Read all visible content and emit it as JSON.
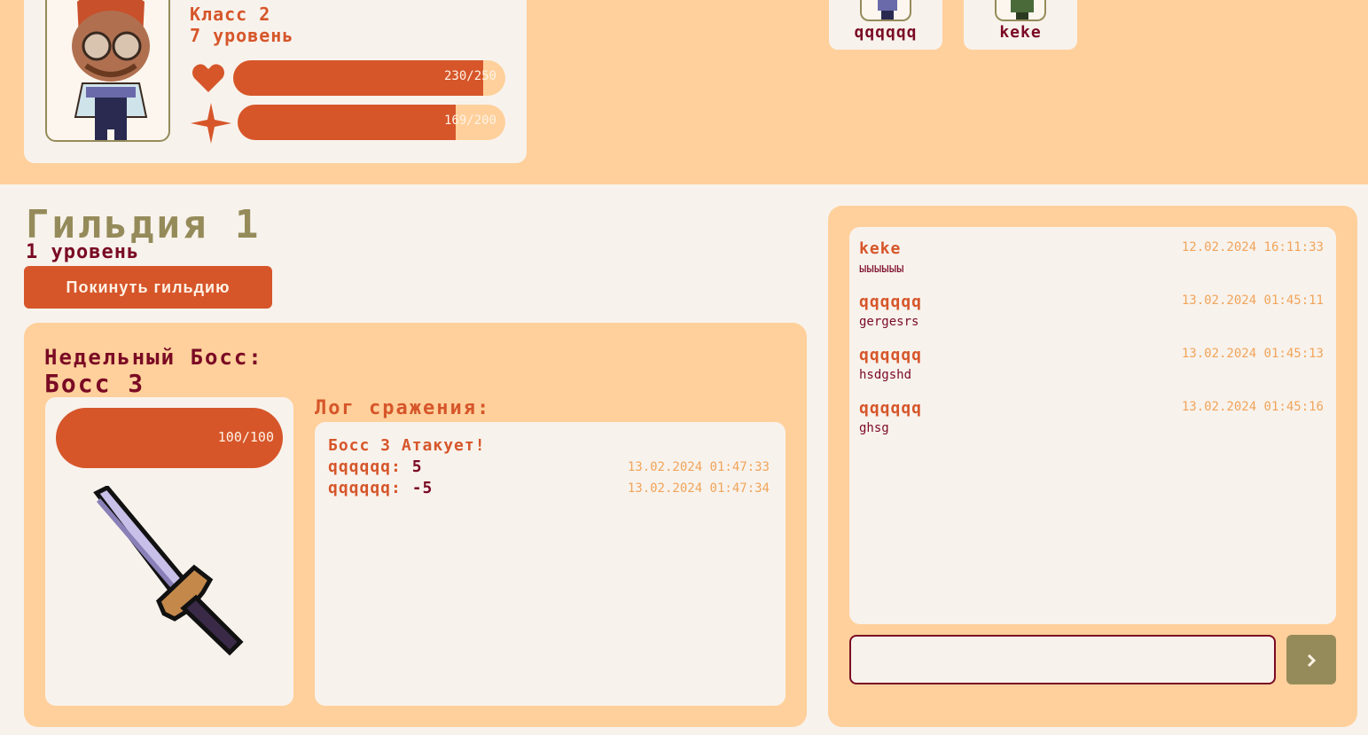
{
  "character": {
    "class_label": "Класс 2",
    "level_label": "7 уровень",
    "hp_text": "230/250",
    "hp_fraction": 0.92,
    "mana_text": "169/200",
    "mana_fraction": 0.815,
    "hp_icon": "heart-icon",
    "mana_icon": "sparkle-icon"
  },
  "members": [
    {
      "name": "qqqqqq"
    },
    {
      "name": "keke"
    }
  ],
  "guild": {
    "title": "Гильдия 1",
    "level": "1 уровень",
    "leave_label": "Покинуть гильдию"
  },
  "boss": {
    "heading": "Недельный Босс:",
    "name": "Босс 3",
    "hp_text": "100/100",
    "hp_fraction": 1.0,
    "image_icon": "sword-icon"
  },
  "log": {
    "title": "Лог сражения:",
    "entries": [
      {
        "text": "Босс 3 Атакует!",
        "time": ""
      },
      {
        "author": "qqqqqq:",
        "value": "5",
        "time": "13.02.2024 01:47:33"
      },
      {
        "author": "qqqqqq:",
        "value": "-5",
        "time": "13.02.2024 01:47:34"
      }
    ]
  },
  "chat": {
    "messages": [
      {
        "author": "keke",
        "time": "12.02.2024 16:11:33",
        "text": "ыыыыыы"
      },
      {
        "author": "qqqqqq",
        "time": "13.02.2024 01:45:11",
        "text": "gergesrs"
      },
      {
        "author": "qqqqqq",
        "time": "13.02.2024 01:45:13",
        "text": "hsdgshd"
      },
      {
        "author": "qqqqqq",
        "time": "13.02.2024 01:45:16",
        "text": "ghsg"
      }
    ],
    "input_value": "",
    "input_placeholder": "",
    "send_icon": "chevron-right-icon"
  },
  "colors": {
    "accent": "#d6562a",
    "peach": "#ffd09b",
    "cream": "#f8f2ec",
    "olive": "#958b5a",
    "maroon": "#7a0a24",
    "time": "#f0a45a"
  }
}
